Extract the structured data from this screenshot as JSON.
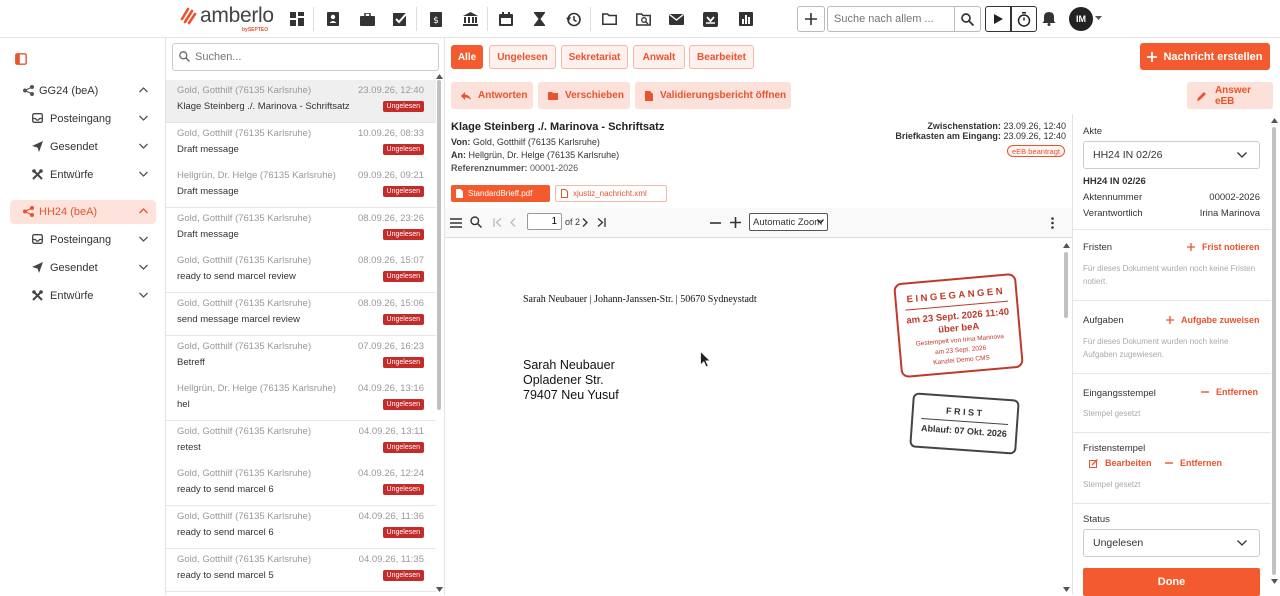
{
  "brand": {
    "name": "amberlo",
    "sub": "bySEPTEO",
    "accent": "#f35b2e"
  },
  "topbar": {
    "nav_icons": [
      "dashboard-icon",
      "contacts-icon",
      "briefcase-icon",
      "checklist-icon",
      "invoice-icon",
      "bank-icon",
      "calendar-icon",
      "hourglass-icon",
      "history-icon",
      "folder-icon",
      "folder-search-icon",
      "mail-icon",
      "inbox-icon",
      "reports-icon"
    ],
    "search_placeholder": "Suche nach allem ...",
    "avatar": "IM"
  },
  "sidebar": {
    "accounts": [
      {
        "label": "GG24 (beA)",
        "active": false,
        "items": [
          "Posteingang",
          "Gesendet",
          "Entwürfe"
        ]
      },
      {
        "label": "HH24 (beA)",
        "active": true,
        "items": [
          "Posteingang",
          "Gesendet",
          "Entwürfe"
        ]
      }
    ]
  },
  "list": {
    "search_placeholder": "Suchen...",
    "messages": [
      {
        "from": "Gold, Gotthilf (76135 Karlsruhe)",
        "date": "23.09.26, 12:40",
        "subject": "Klage Steinberg ./. Marinova - Schriftsatz",
        "badge": "Ungelesen",
        "selected": true
      },
      {
        "from": "Gold, Gotthilf (76135 Karlsruhe)",
        "date": "10.09.26, 08:33",
        "subject": "Draft message",
        "badge": "Ungelesen"
      },
      {
        "from": "Hellgrün, Dr. Helge (76135 Karlsruhe)",
        "date": "09.09.26, 09:21",
        "subject": "Draft message",
        "badge": "Ungelesen"
      },
      {
        "from": "Gold, Gotthilf (76135 Karlsruhe)",
        "date": "08.09.26, 23:26",
        "subject": "Draft message",
        "badge": "Ungelesen"
      },
      {
        "from": "Gold, Gotthilf (76135 Karlsruhe)",
        "date": "08.09.26, 15:07",
        "subject": "ready to send marcel review",
        "badge": "Ungelesen"
      },
      {
        "from": "Gold, Gotthilf (76135 Karlsruhe)",
        "date": "08.09.26, 15:06",
        "subject": "send message marcel review",
        "badge": "Ungelesen"
      },
      {
        "from": "Gold, Gotthilf (76135 Karlsruhe)",
        "date": "07.09.26, 16:23",
        "subject": "Betreff",
        "badge": "Ungelesen"
      },
      {
        "from": "Hellgrün, Dr. Helge (76135 Karlsruhe)",
        "date": "04.09.26, 13:16",
        "subject": "hel",
        "badge": "Ungelesen"
      },
      {
        "from": "Gold, Gotthilf (76135 Karlsruhe)",
        "date": "04.09.26, 13:11",
        "subject": "retest",
        "badge": "Ungelesen"
      },
      {
        "from": "Gold, Gotthilf (76135 Karlsruhe)",
        "date": "04.09.26, 12:24",
        "subject": "ready to send marcel 6",
        "badge": "Ungelesen"
      },
      {
        "from": "Gold, Gotthilf (76135 Karlsruhe)",
        "date": "04.09.26, 11:36",
        "subject": "ready to send marcel 6",
        "badge": "Ungelesen"
      },
      {
        "from": "Gold, Gotthilf (76135 Karlsruhe)",
        "date": "04.09.26, 11:35",
        "subject": "ready to send marcel 5",
        "badge": "Ungelesen"
      }
    ]
  },
  "filters": [
    "Alle",
    "Ungelesen",
    "Sekretariat",
    "Anwalt",
    "Bearbeitet"
  ],
  "new_message": "Nachricht erstellen",
  "actions": {
    "reply": "Antworten",
    "move": "Verschieben",
    "validation": "Validierungsbericht öffnen",
    "answer_eeb": "Answer eEB"
  },
  "message": {
    "title": "Klage Steinberg ./. Marinova - Schriftsatz",
    "from_label": "Von:",
    "from": "Gold, Gotthilf (76135 Karlsruhe)",
    "to_label": "An:",
    "to": "Hellgrün, Dr. Helge (76135 Karlsruhe)",
    "ref_label": "Referenznummer:",
    "ref": "00001-2026",
    "station_label": "Zwischenstation:",
    "station": "23.09.26, 12:40",
    "inbox_label": "Briefkasten am Eingang:",
    "inbox": "23.09.26, 12:40",
    "eeb": "eEB beantragt",
    "attachments": [
      "StandardBrieff.pdf",
      "xjustiz_nachricht.xml"
    ]
  },
  "pdf": {
    "page": "1",
    "of": "of 2",
    "zoom": "Automatic Zoom",
    "sender_line": "Sarah Neubauer | Johann-Janssen-Str. | 50670 Sydneystadt",
    "address": [
      "Sarah Neubauer",
      "Opladener Str.",
      "79407 Neu Yusuf"
    ],
    "stamp_received": {
      "title": "EINGEGANGEN",
      "date": "am 23 Sept. 2026 11:40",
      "via": "über beA",
      "line1": "Gestempelt von Irina Marinova",
      "line2": "am 23 Sept. 2026",
      "line3": "Kanzlei Demo CMS"
    },
    "stamp_deadline": {
      "title": "FRIST",
      "date": "Ablauf: 07 Okt. 2026"
    }
  },
  "panel": {
    "akte_label": "Akte",
    "akte_value": "HH24 IN 02/26",
    "akte_title": "HH24 IN 02/26",
    "aktennummer_label": "Aktennummer",
    "aktennummer": "00002-2026",
    "verantwortlich_label": "Verantwortlich",
    "verantwortlich": "Irina Marinova",
    "fristen_label": "Fristen",
    "frist_btn": "Frist notieren",
    "fristen_hint": "Für dieses Dokument wurden noch keine Fristen notiert.",
    "aufgaben_label": "Aufgaben",
    "aufgabe_btn": "Aufgabe zuweisen",
    "aufgaben_hint": "Für dieses Dokument wurden noch keine Aufgaben zugewiesen.",
    "eingangsstempel_label": "Eingangsstempel",
    "remove": "Entfernen",
    "stempel_gesetzt": "Stempel gesetzt",
    "fristenstempel_label": "Fristenstempel",
    "edit": "Bearbeiten",
    "status_label": "Status",
    "status_value": "Ungelesen",
    "done": "Done"
  }
}
